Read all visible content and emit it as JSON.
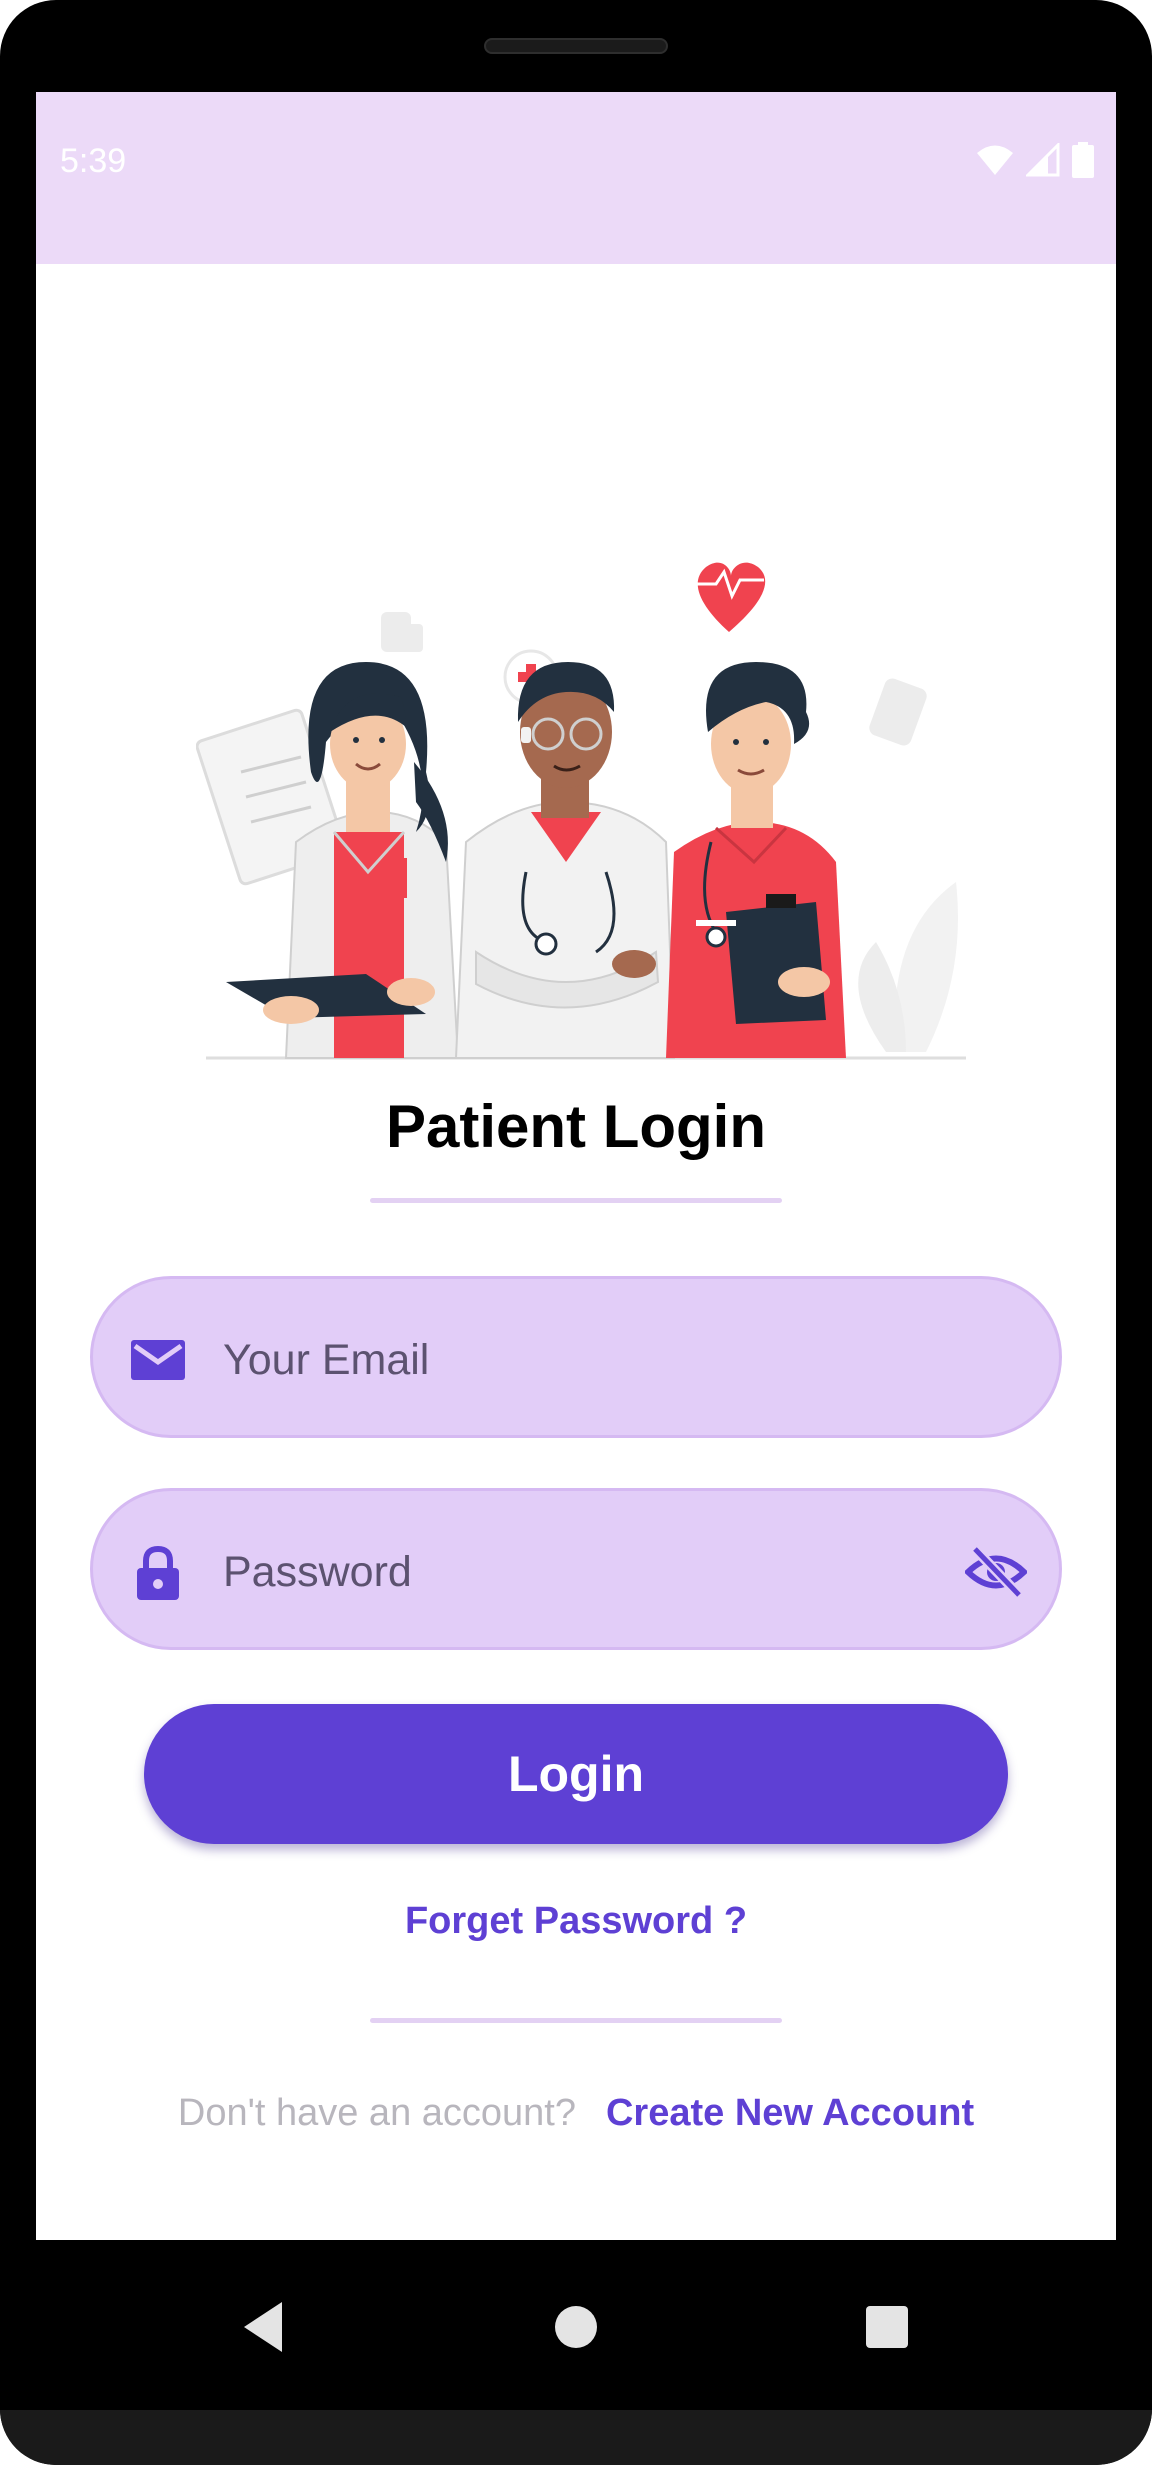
{
  "status_bar": {
    "time": "5:39",
    "icons": [
      "wifi-icon",
      "signal-icon",
      "battery-icon"
    ]
  },
  "login": {
    "title": "Patient Login",
    "email": {
      "placeholder": "Your Email",
      "icon": "mail-icon"
    },
    "password": {
      "placeholder": "Password",
      "icon": "lock-icon",
      "toggle_icon": "eye-off-icon"
    },
    "button_label": "Login",
    "forgot_label": "Forget Password ?",
    "signup_prompt": "Don't have an account?",
    "signup_link": "Create New Account"
  },
  "nav": {
    "icons": [
      "back-icon",
      "home-icon",
      "recents-icon"
    ]
  },
  "colors": {
    "accent": "#5e40d4",
    "field_bg": "#e2cdf8",
    "status_bar_bg": "#ecdaf8",
    "divider": "#e3d1f3",
    "illustration_red": "#f0434f"
  }
}
